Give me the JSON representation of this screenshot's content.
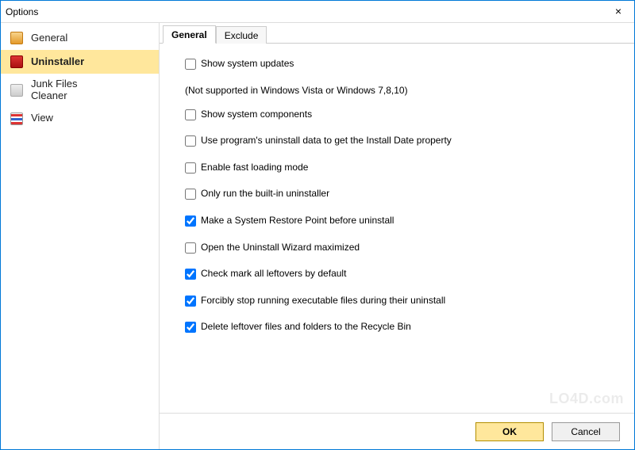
{
  "window": {
    "title": "Options",
    "close_glyph": "×"
  },
  "sidebar": {
    "items": [
      {
        "label": "General"
      },
      {
        "label": "Uninstaller"
      },
      {
        "label": "Junk Files\nCleaner"
      },
      {
        "label": "View"
      }
    ],
    "selected_index": 1
  },
  "tabs": [
    {
      "label": "General"
    },
    {
      "label": "Exclude"
    }
  ],
  "active_tab_index": 0,
  "options": [
    {
      "label": "Show system updates",
      "sub": "(Not supported in Windows Vista or Windows 7,8,10)",
      "checked": false
    },
    {
      "label": "Show system components",
      "checked": false
    },
    {
      "label": "Use program's uninstall data to get the Install Date property",
      "checked": false
    },
    {
      "label": "Enable fast loading mode",
      "checked": false
    },
    {
      "label": "Only run the built-in uninstaller",
      "checked": false
    },
    {
      "label": "Make a System Restore Point before uninstall",
      "checked": true
    },
    {
      "label": "Open the Uninstall Wizard maximized",
      "checked": false
    },
    {
      "label": "Check mark all leftovers by default",
      "checked": true
    },
    {
      "label": "Forcibly stop running executable files during their uninstall",
      "checked": true
    },
    {
      "label": "Delete leftover files and folders to the Recycle Bin",
      "checked": true
    }
  ],
  "buttons": {
    "ok": "OK",
    "cancel": "Cancel"
  },
  "watermark": "LO4D.com"
}
